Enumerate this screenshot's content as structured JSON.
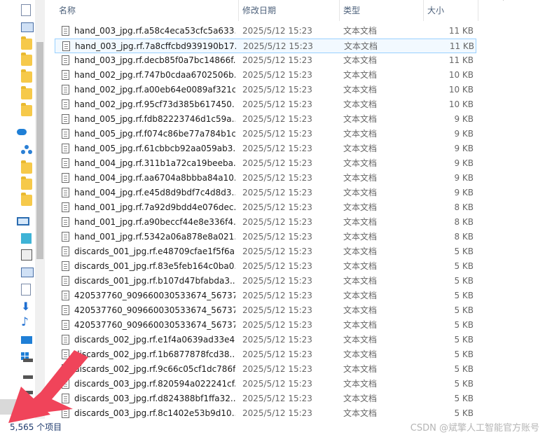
{
  "header": {
    "name": "名称",
    "date": "修改日期",
    "type": "类型",
    "size": "大小"
  },
  "rows": [
    {
      "name": "hand_003_jpg.rf.a58c4eca53cfc5a633...",
      "date": "2025/5/12 15:23",
      "type": "文本文档",
      "size": "11 KB"
    },
    {
      "name": "hand_003_jpg.rf.7a8cffcbd939190b17...",
      "date": "2025/5/12 15:23",
      "type": "文本文档",
      "size": "11 KB"
    },
    {
      "name": "hand_003_jpg.rf.decb85f0a7bc14866f...",
      "date": "2025/5/12 15:23",
      "type": "文本文档",
      "size": "11 KB"
    },
    {
      "name": "hand_002_jpg.rf.747b0cdaa6702506b...",
      "date": "2025/5/12 15:23",
      "type": "文本文档",
      "size": "10 KB"
    },
    {
      "name": "hand_002_jpg.rf.a00eb64e0089af321c...",
      "date": "2025/5/12 15:23",
      "type": "文本文档",
      "size": "10 KB"
    },
    {
      "name": "hand_002_jpg.rf.95cf73d385b617450...",
      "date": "2025/5/12 15:23",
      "type": "文本文档",
      "size": "10 KB"
    },
    {
      "name": "hand_005_jpg.rf.fdb82223746d1c59a...",
      "date": "2025/5/12 15:23",
      "type": "文本文档",
      "size": "9 KB"
    },
    {
      "name": "hand_005_jpg.rf.f074c86be77a784b1c...",
      "date": "2025/5/12 15:23",
      "type": "文本文档",
      "size": "9 KB"
    },
    {
      "name": "hand_005_jpg.rf.61cbbcb92aa059ab3...",
      "date": "2025/5/12 15:23",
      "type": "文本文档",
      "size": "9 KB"
    },
    {
      "name": "hand_004_jpg.rf.311b1a72ca19beeba...",
      "date": "2025/5/12 15:23",
      "type": "文本文档",
      "size": "9 KB"
    },
    {
      "name": "hand_004_jpg.rf.aa6704a8bbba84a10...",
      "date": "2025/5/12 15:23",
      "type": "文本文档",
      "size": "9 KB"
    },
    {
      "name": "hand_004_jpg.rf.e45d8d9bdf7c4d8d3...",
      "date": "2025/5/12 15:23",
      "type": "文本文档",
      "size": "9 KB"
    },
    {
      "name": "hand_001_jpg.rf.7a92d9bdd4e076dec...",
      "date": "2025/5/12 15:23",
      "type": "文本文档",
      "size": "8 KB"
    },
    {
      "name": "hand_001_jpg.rf.a90beccf44e8e336f4...",
      "date": "2025/5/12 15:23",
      "type": "文本文档",
      "size": "8 KB"
    },
    {
      "name": "hand_001_jpg.rf.5342a06a878e8a021...",
      "date": "2025/5/12 15:23",
      "type": "文本文档",
      "size": "8 KB"
    },
    {
      "name": "discards_001_jpg.rf.e48709cfae1f5f6a...",
      "date": "2025/5/12 15:23",
      "type": "文本文档",
      "size": "5 KB"
    },
    {
      "name": "discards_001_jpg.rf.83e5feb164c0ba0...",
      "date": "2025/5/12 15:23",
      "type": "文本文档",
      "size": "5 KB"
    },
    {
      "name": "discards_001_jpg.rf.b107d47bfabda3...",
      "date": "2025/5/12 15:23",
      "type": "文本文档",
      "size": "5 KB"
    },
    {
      "name": "420537760_909660030533674_56737...",
      "date": "2025/5/12 15:23",
      "type": "文本文档",
      "size": "5 KB"
    },
    {
      "name": "420537760_909660030533674_56737...",
      "date": "2025/5/12 15:23",
      "type": "文本文档",
      "size": "5 KB"
    },
    {
      "name": "420537760_909660030533674_56737...",
      "date": "2025/5/12 15:23",
      "type": "文本文档",
      "size": "5 KB"
    },
    {
      "name": "discards_002_jpg.rf.e1f4a0639ad33e4...",
      "date": "2025/5/12 15:23",
      "type": "文本文档",
      "size": "5 KB"
    },
    {
      "name": "discards_002_jpg.rf.1b6877878fcd38...",
      "date": "2025/5/12 15:23",
      "type": "文本文档",
      "size": "5 KB"
    },
    {
      "name": "discards_002_jpg.rf.9c66c05cf1dc786f...",
      "date": "2025/5/12 15:23",
      "type": "文本文档",
      "size": "5 KB"
    },
    {
      "name": "discards_003_jpg.rf.820594a022241cf...",
      "date": "2025/5/12 15:23",
      "type": "文本文档",
      "size": "5 KB"
    },
    {
      "name": "discards_003_jpg.rf.d824388bf1ffa32...",
      "date": "2025/5/12 15:23",
      "type": "文本文档",
      "size": "5 KB"
    },
    {
      "name": "discards_003_jpg.rf.8c1402e53b9d10...",
      "date": "2025/5/12 15:23",
      "type": "文本文档",
      "size": "5 KB"
    }
  ],
  "status": {
    "item_count": "5,565 个项目"
  },
  "watermark": "CSDN @斌擎人工智能官方账号",
  "colors": {
    "annotation_arrow": "#f0445a",
    "hover_border": "#99d1ff",
    "header_text": "#4c607a"
  }
}
